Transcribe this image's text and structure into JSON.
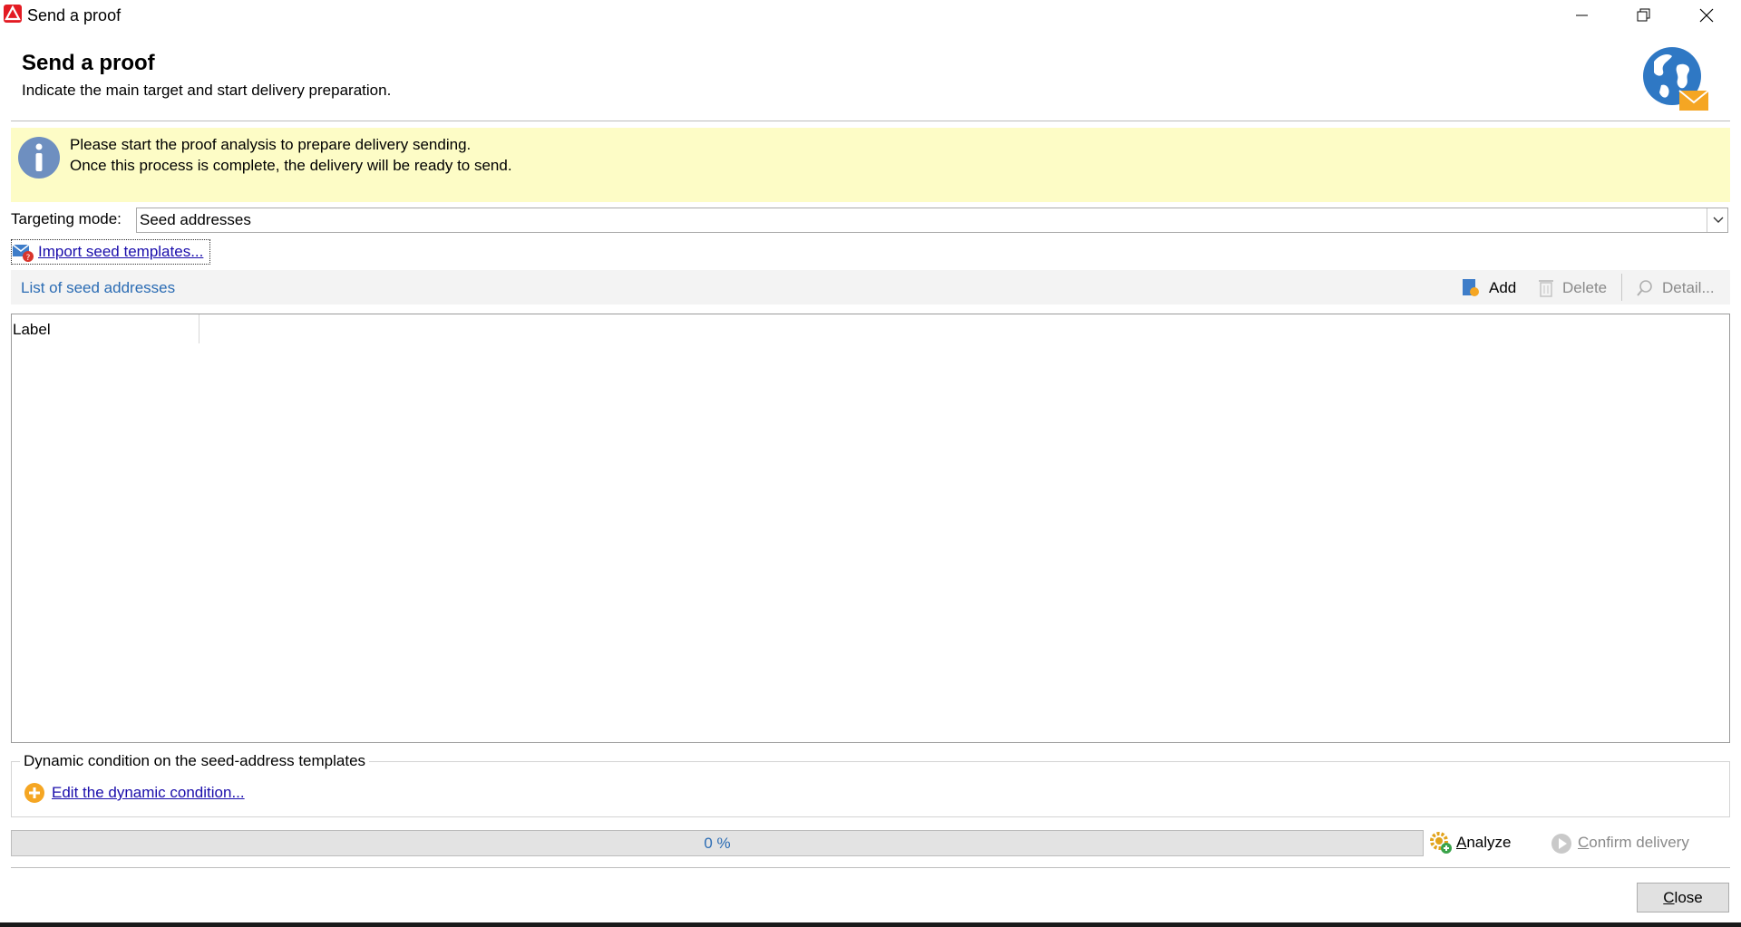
{
  "window": {
    "title": "Send a proof"
  },
  "header": {
    "title": "Send a proof",
    "subtitle": "Indicate the main target and start delivery preparation."
  },
  "banner": {
    "line1": "Please start the proof analysis to prepare delivery sending.",
    "line2": "Once this process is complete, the delivery will be ready to send."
  },
  "targeting": {
    "label": "Targeting mode:",
    "value": "Seed addresses"
  },
  "import_link": "Import seed templates...",
  "list": {
    "title": "List of seed addresses",
    "add_label": "Add",
    "delete_label": "Delete",
    "detail_label": "Detail...",
    "columns": [
      "Label"
    ]
  },
  "dynamic": {
    "legend": "Dynamic condition on the seed-address templates",
    "edit_link": "Edit the dynamic condition..."
  },
  "progress": {
    "value_percent": 0,
    "text": "0 %"
  },
  "actions": {
    "analyze_prefix": "A",
    "analyze_rest": "nalyze",
    "confirm_prefix": "C",
    "confirm_rest": "onfirm delivery",
    "close_prefix": "C",
    "close_rest": "lose"
  },
  "colors": {
    "banner_bg": "#fdfcc6",
    "link": "#1a0dab",
    "accent_blue": "#2b6cb4",
    "brand_red": "#e31b23"
  }
}
